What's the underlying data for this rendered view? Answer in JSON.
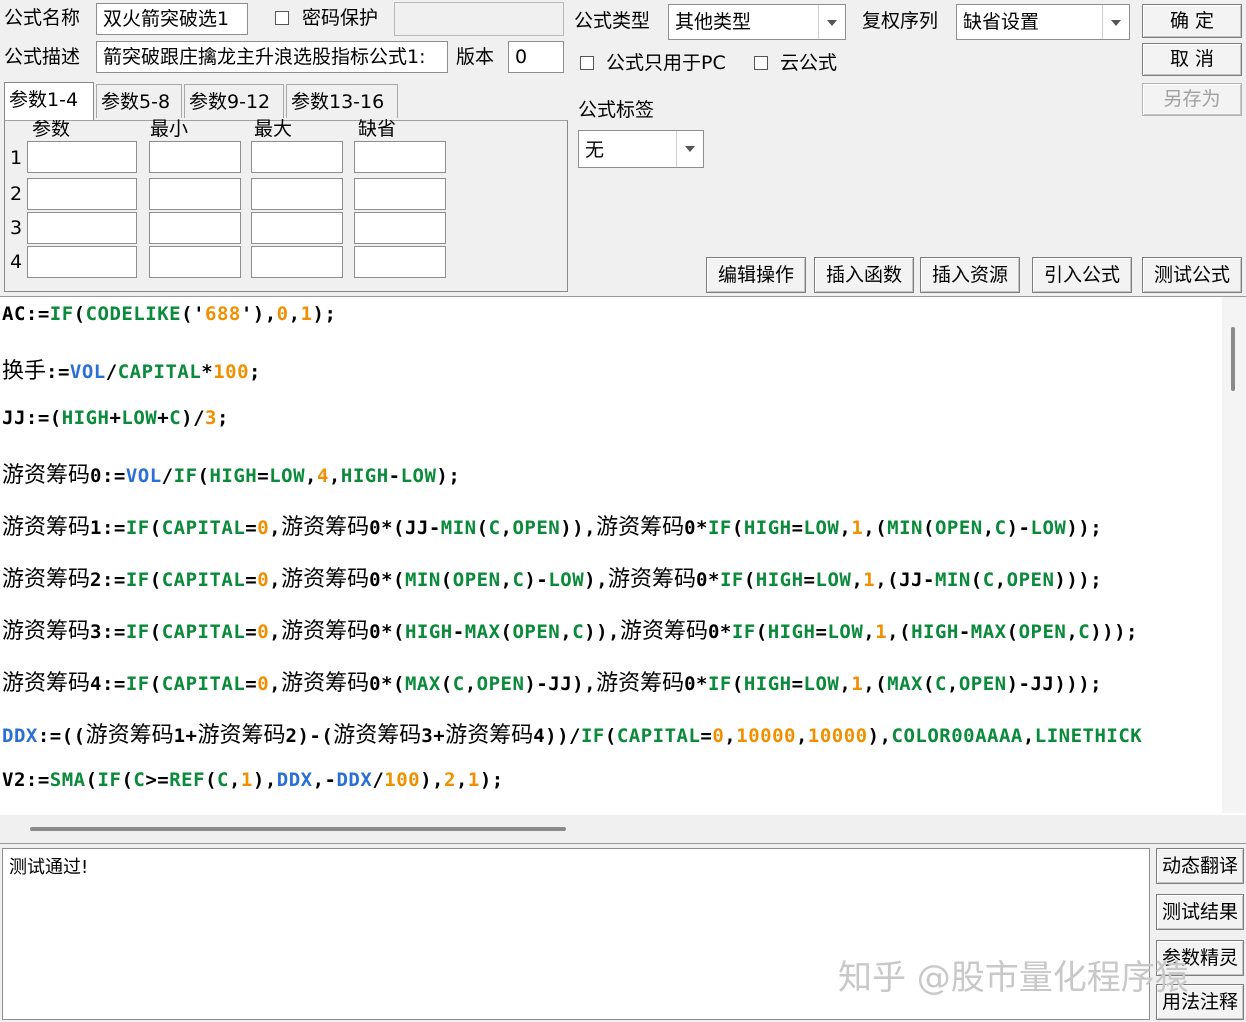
{
  "header": {
    "name_label": "公式名称",
    "name_value": "双火箭突破选1",
    "password_label": "密码保护",
    "desc_label": "公式描述",
    "desc_value": "箭突破跟庄擒龙主升浪选股指标公式1:",
    "version_label": "版本",
    "version_value": "0",
    "type_label": "公式类型",
    "type_value": "其他类型",
    "rights_label": "复权序列",
    "rights_value": "缺省设置",
    "pc_only_label": "公式只用于PC",
    "cloud_label": "云公式",
    "tag_label": "公式标签",
    "tag_value": "无"
  },
  "buttons": {
    "ok": "确 定",
    "cancel": "取 消",
    "save_as": "另存为",
    "edit_ops": "编辑操作",
    "insert_func": "插入函数",
    "insert_res": "插入资源",
    "import_formula": "引入公式",
    "test_formula": "测试公式",
    "dynamic_translate": "动态翻译",
    "test_result": "测试结果",
    "param_wizard": "参数精灵",
    "usage_note": "用法注释"
  },
  "params": {
    "tabs": [
      "参数1-4",
      "参数5-8",
      "参数9-12",
      "参数13-16"
    ],
    "columns": [
      "参数",
      "最小",
      "最大",
      "缺省"
    ],
    "rows": [
      "1",
      "2",
      "3",
      "4"
    ]
  },
  "output": {
    "message": "测试通过!"
  },
  "watermark": "知乎 @股市量化程序猿",
  "colors": {
    "function": "#0a8a3a",
    "number": "#f09000",
    "keyword": "#2a6fd6"
  }
}
